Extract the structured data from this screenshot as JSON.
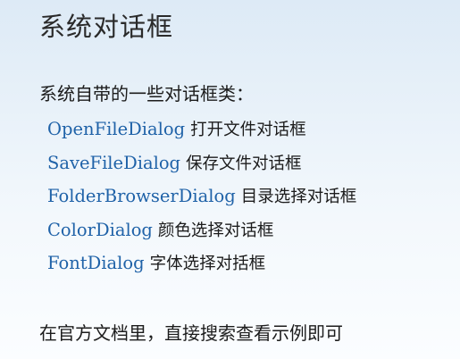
{
  "title": "系统对话框",
  "intro": "系统自带的一些对话框类：",
  "items": [
    {
      "name": "OpenFileDialog",
      "desc": "打开文件对话框"
    },
    {
      "name": "SaveFileDialog",
      "desc": "保存文件对话框"
    },
    {
      "name": "FolderBrowserDialog",
      "desc": "目录选择对话框"
    },
    {
      "name": "ColorDialog",
      "desc": "颜色选择对话框"
    },
    {
      "name": "FontDialog",
      "desc": "字体选择对括框"
    }
  ],
  "footer": "在官方文档里，直接搜索查看示例即可",
  "colors": {
    "class_name": "#1f62a8",
    "text": "#1c1c1c",
    "background_top": "#ddeaf6",
    "background_bottom": "#fbfdff"
  }
}
